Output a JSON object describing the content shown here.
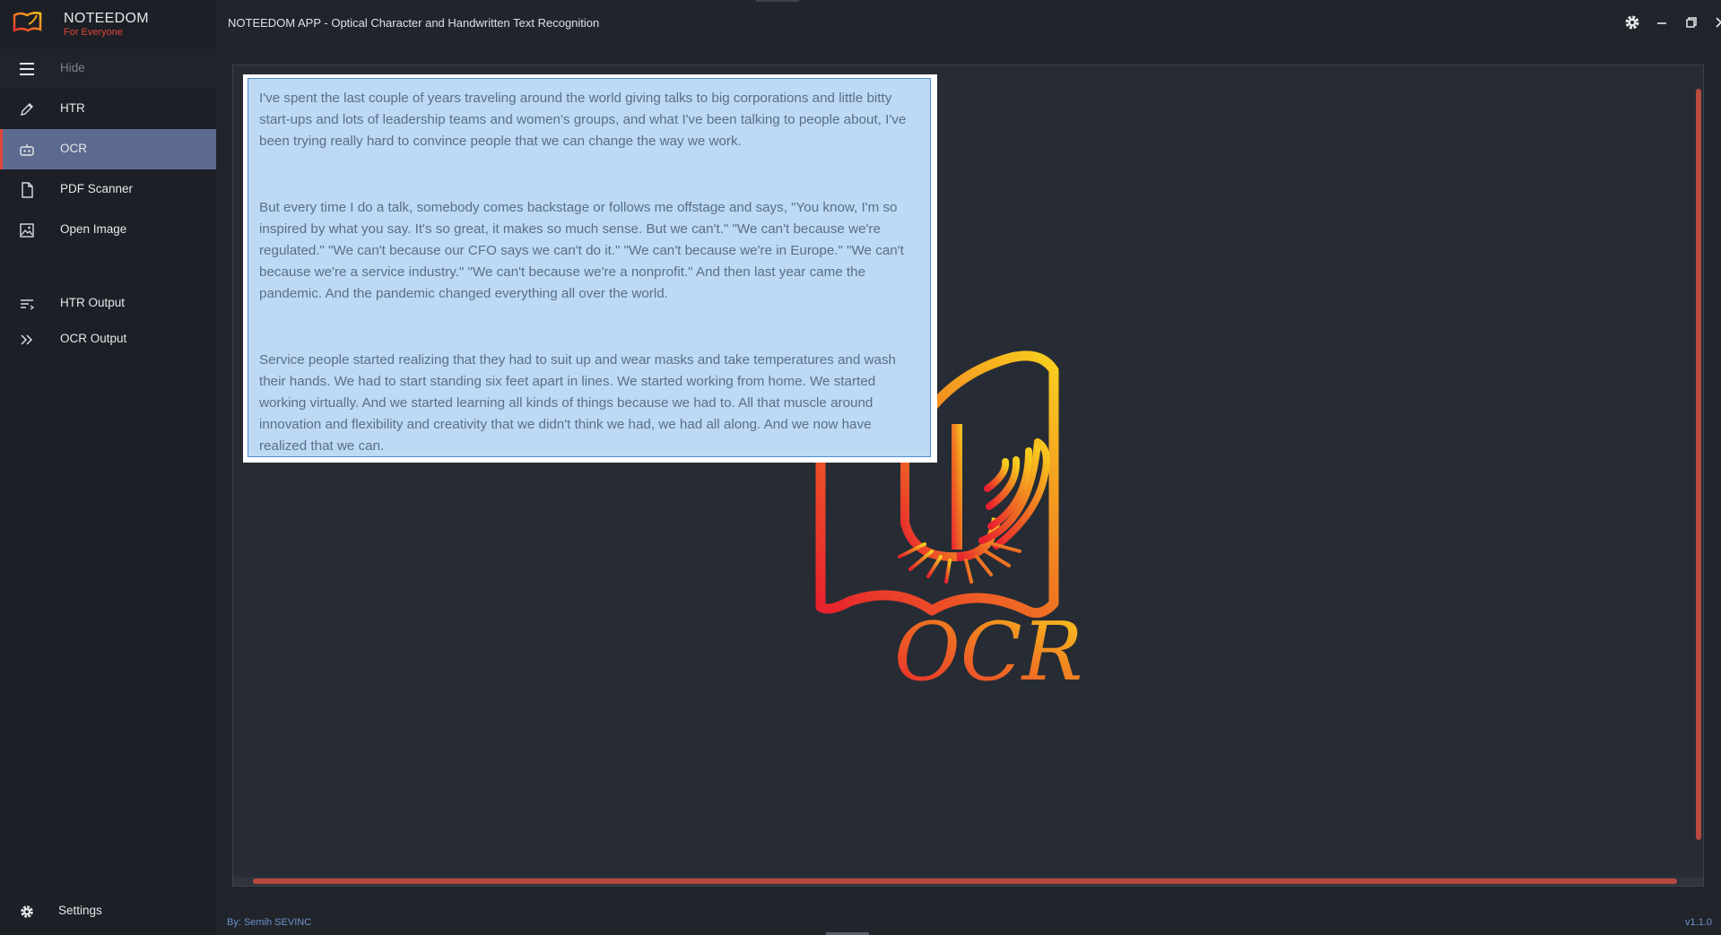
{
  "brand": {
    "name": "NOTEEDOM",
    "tagline": "For Everyone"
  },
  "window": {
    "title": "NOTEEDOM APP - Optical Character and Handwritten Text Recognition"
  },
  "sidebar": {
    "toggle_label": "Hide",
    "items": [
      {
        "label": "HTR",
        "icon": "pencil-icon"
      },
      {
        "label": "OCR",
        "icon": "robot-icon",
        "active": true
      },
      {
        "label": "PDF Scanner",
        "icon": "document-icon"
      },
      {
        "label": "Open Image",
        "icon": "image-icon"
      },
      {
        "label": "HTR Output",
        "icon": "text-lines-icon"
      },
      {
        "label": "OCR Output",
        "icon": "double-chevron-icon"
      }
    ],
    "settings_label": "Settings"
  },
  "viewer": {
    "logo_text": "OCR",
    "text_image": {
      "paragraphs": [
        "I've spent the last couple of years traveling around the world giving talks to big corporations and little bitty start-ups and lots of leadership teams and women's groups, and what I've been talking to people about, I've been trying really hard to convince people that we can change the way we work.",
        "But every time I do a talk, somebody comes backstage or follows me offstage and says, \"You know, I'm so inspired by what you say. It's so great, it makes so much sense. But we can't.\" \"We can't because we're regulated.\" \"We can't because our CFO says we can't do it.\" \"We can't because we're in Europe.\" \"We can't because we're a service industry.\" \"We can't because we're a nonprofit.\" And then last year came the pandemic. And the pandemic changed everything all over the world.",
        "Service people started realizing that they had to suit up and wear masks and take temperatures and wash their hands. We had to start standing six feet apart in lines. We started working from home. We started working virtually. And we started learning all kinds of things because we had to. All that muscle around innovation and flexibility and creativity that we didn't think we had, we had all along. And we now have realized that we can."
      ]
    }
  },
  "footer": {
    "author": "By: Semih SEVINC",
    "version": "v1.1.0"
  },
  "colors": {
    "accent": "#e2463a",
    "active_item": "#5d6a8f",
    "scrollbar": "#b94a40",
    "link": "#6d93c9"
  }
}
